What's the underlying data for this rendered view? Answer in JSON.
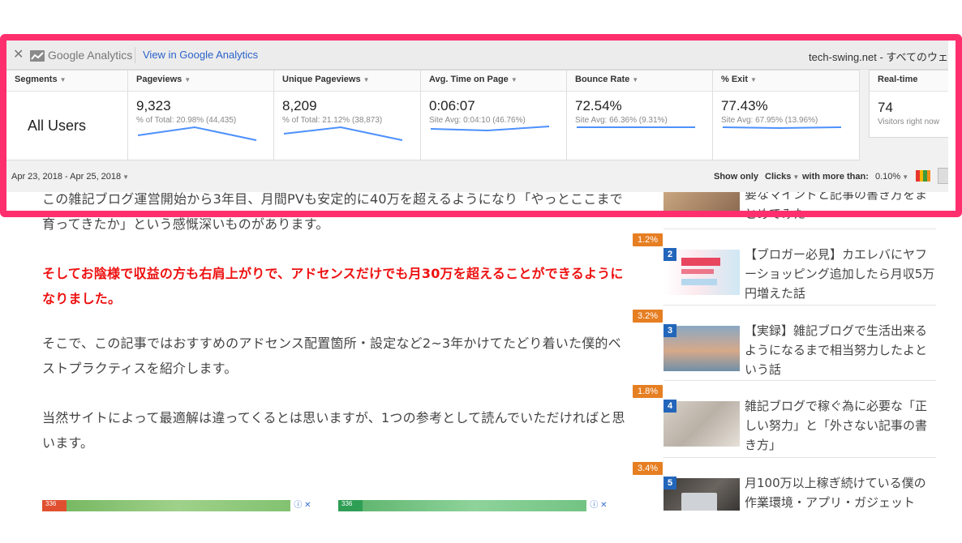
{
  "article": {
    "para1": "この雑記ブログ運営開始から3年目、月間PVも安定的に40万を超えるようになり「やっとここまで育ってきたか」という感慨深いものがあります。",
    "para2": "そしてお陰様で収益の方も右肩上がりで、アドセンスだけでも月30万を超えることができるようになりました。",
    "para3": "そこで、この記事ではおすすめのアドセンス配置箇所・設定など2~3年かけてたどり着いた僕的ベストプラクティスを紹介します。",
    "para4": "当然サイトによって最適解は違ってくるとは思いますが、1つの参考として読んでいただければと思います。",
    "ad_tag": "336",
    "ad_close": "ⓘ ✕"
  },
  "sidebar": {
    "items": [
      {
        "pct": "",
        "num": "",
        "title": "要なマインドと記事の書き方をまとめてみた"
      },
      {
        "pct": "1.2%",
        "num": "2",
        "title": "【ブロガー必見】カエレバにヤフーショッピング追加したら月収5万円増えた話",
        "thumb_text": "カエレバ ヤフーショッピング"
      },
      {
        "pct": "3.2%",
        "num": "3",
        "title": "【実録】雑記ブログで生活出来るようになるまで相当努力したよという話"
      },
      {
        "pct": "1.8%",
        "num": "4",
        "title": "雑記ブログで稼ぐ為に必要な「正しい努力」と「外さない記事の書き方」"
      },
      {
        "pct": "3.4%",
        "num": "5",
        "title": "月100万以上稼ぎ続けている僕の作業環境・アプリ・ガジェット"
      }
    ]
  },
  "ga": {
    "close": "✕",
    "logo_text": "Google Analytics",
    "view_link": "View in Google Analytics",
    "site": "tech-swing.net - すべてのウェ",
    "segments_header": "Segments",
    "segment_value": "All Users",
    "metrics": [
      {
        "header": "Pageviews",
        "value": "9,323",
        "sub": "% of Total: 20.98% (44,435)"
      },
      {
        "header": "Unique Pageviews",
        "value": "8,209",
        "sub": "% of Total: 21.12% (38,873)"
      },
      {
        "header": "Avg. Time on Page",
        "value": "0:06:07",
        "sub": "Site Avg: 0:04:10 (46.76%)"
      },
      {
        "header": "Bounce Rate",
        "value": "72.54%",
        "sub": "Site Avg: 66.36% (9.31%)"
      },
      {
        "header": "% Exit",
        "value": "77.43%",
        "sub": "Site Avg: 67.95% (13.96%)"
      }
    ],
    "realtime": {
      "header": "Real-time",
      "value": "74",
      "sub": "Visitors right now"
    },
    "date_range": "Apr 23, 2018 - Apr 25, 2018",
    "show_only": "Show only",
    "clicks": "Clicks",
    "with_more_than": "with more than:",
    "threshold": "0.10%",
    "sparkline_color": "#4d90fe",
    "frame_color": "#ff2f6e"
  }
}
